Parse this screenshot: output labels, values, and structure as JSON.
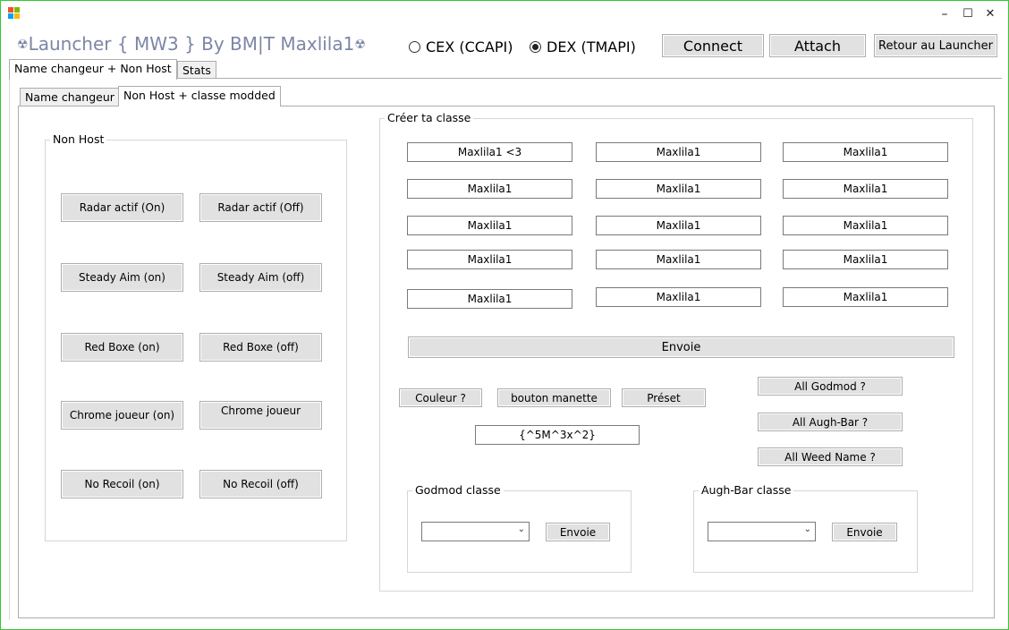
{
  "window": {
    "title": "Launcher { MW3 } By BM|T Maxlila1",
    "title_prefix_icon": "☢",
    "title_suffix_icon": "☢",
    "minimize_glyph": "–",
    "maximize_glyph": "☐",
    "close_glyph": "✕"
  },
  "api": {
    "cex_label": "CEX (CCAPI)",
    "dex_label": "DEX (TMAPI)",
    "selected": "dex"
  },
  "toolbar": {
    "connect_label": "Connect",
    "attach_label": "Attach",
    "back_label": "Retour au Launcher"
  },
  "main_tabs": [
    {
      "label": "Name changeur + Non Host",
      "selected": true
    },
    {
      "label": "Stats",
      "selected": false
    }
  ],
  "sub_tabs": [
    {
      "label": "Name changeur",
      "selected": false
    },
    {
      "label": "Non Host + classe modded",
      "selected": true
    }
  ],
  "non_host": {
    "legend": "Non Host",
    "buttons": [
      [
        "Radar actif (On)",
        "Radar actif  (Off)"
      ],
      [
        "Steady Aim (on)",
        "Steady Aim (off)"
      ],
      [
        "Red Boxe (on)",
        "Red Boxe (off)"
      ],
      [
        "Chrome joueur (on)",
        "Chrome joueur"
      ],
      [
        "No Recoil (on)",
        "No Recoil (off)"
      ]
    ]
  },
  "class_creator": {
    "legend": "Créer ta classe",
    "fields": [
      [
        "Maxlila1 <3",
        "Maxlila1",
        "Maxlila1"
      ],
      [
        "Maxlila1",
        "Maxlila1",
        "Maxlila1"
      ],
      [
        "Maxlila1",
        "Maxlila1",
        "Maxlila1"
      ],
      [
        "Maxlila1",
        "Maxlila1",
        "Maxlila1"
      ],
      [
        "Maxlila1",
        "Maxlila1",
        "Maxlila1"
      ]
    ],
    "send_label": "Envoie",
    "color_label": "Couleur ?",
    "controller_label": "bouton manette",
    "preset_label": "Préset",
    "code_value": "{^5M^3x^2}",
    "all_godmod_label": "All Godmod ?",
    "all_augh_label": "All Augh-Bar ?",
    "all_weed_label": "All Weed Name ?"
  },
  "godmod": {
    "legend": "Godmod classe",
    "select_value": "",
    "send_label": "Envoie"
  },
  "augh": {
    "legend": "Augh-Bar classe",
    "select_value": "",
    "send_label": "Envoie"
  },
  "colors": {
    "window_border": "#34c934",
    "title_text": "#7d86a6",
    "button_face": "#e1e1e1",
    "button_border": "#adadad"
  },
  "icons": {
    "app": "app-icon",
    "dropdown": "chevron-down-icon"
  }
}
